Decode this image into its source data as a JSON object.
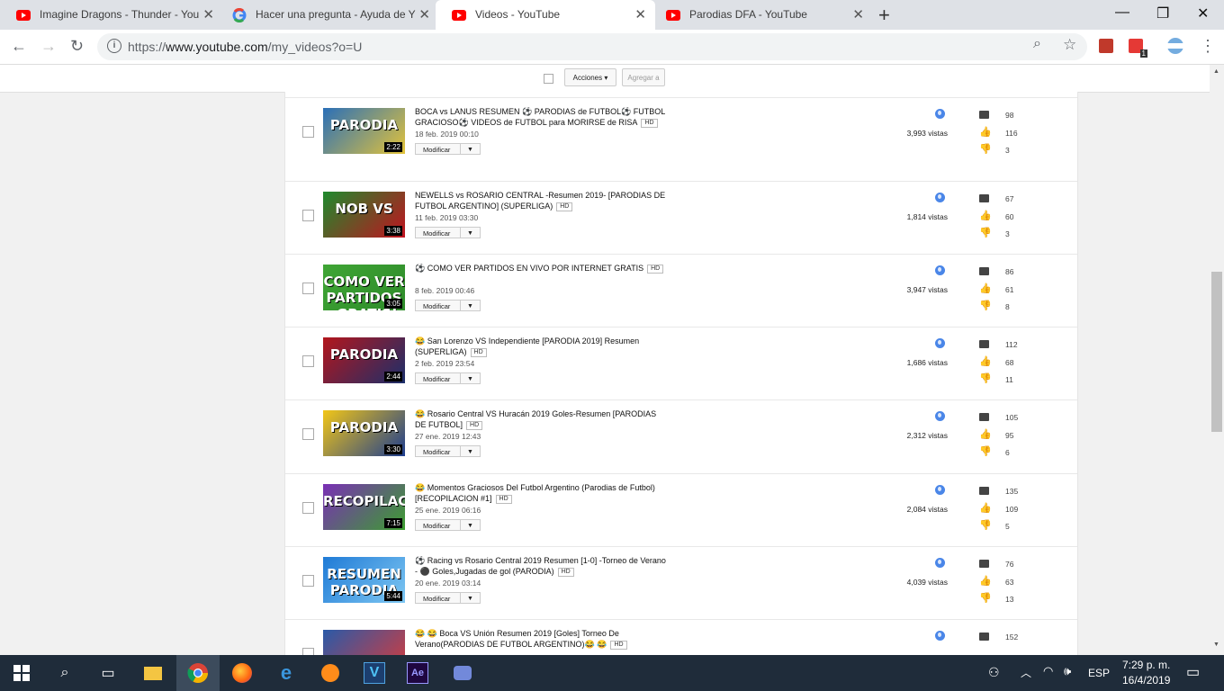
{
  "browser": {
    "tabs": [
      {
        "title": "Imagine Dragons - Thunder - You",
        "icon": "youtube-icon",
        "active": false
      },
      {
        "title": "Hacer una pregunta - Ayuda de Y",
        "icon": "google-icon",
        "active": false
      },
      {
        "title": "Videos - YouTube",
        "icon": "youtube-icon",
        "active": true
      },
      {
        "title": "Parodias DFA - YouTube",
        "icon": "youtube-icon",
        "active": false
      }
    ],
    "url_prefix": "https://",
    "url_host": "www.youtube.com",
    "url_path": "/my_videos?o=U",
    "extension_badge": "1"
  },
  "action_bar": {
    "actions_label": "Acciones",
    "add_label": "Agregar a"
  },
  "videos": [
    {
      "title": "BOCA vs LANUS RESUMEN ⚽ PARODIAS de FUTBOL⚽ FUTBOL GRACIOSO⚽ VIDEOS de FUTBOL para MORIRSE de RISA",
      "hd": "HD",
      "date": "18 feb. 2019 00:10",
      "duration": "2:22",
      "thumb_text": "PARODIA",
      "views": "3,993 vistas",
      "comments": "98",
      "likes": "116",
      "dislikes": "3",
      "colors": [
        "#2a6fb8",
        "#e3c33a"
      ]
    },
    {
      "title": "NEWELLS vs ROSARIO CENTRAL -Resumen 2019- [PARODIAS DE FUTBOL ARGENTINO] (SUPERLIGA)",
      "hd": "HD",
      "date": "11 feb. 2019 03:30",
      "duration": "3:38",
      "thumb_text": "NOB VS",
      "views": "1,814 vistas",
      "comments": "67",
      "likes": "60",
      "dislikes": "3",
      "colors": [
        "#1e8a2d",
        "#c1121f"
      ]
    },
    {
      "title": "⚽ COMO VER PARTIDOS EN VIVO POR INTERNET GRATIS",
      "hd": "HD",
      "date": "8 feb. 2019 00:46",
      "duration": "3:05",
      "thumb_text": "COMO VER PARTIDOS ¡GRATIS!",
      "views": "3,947 vistas",
      "comments": "86",
      "likes": "61",
      "dislikes": "8",
      "colors": [
        "#3fa535",
        "#2e8b2a"
      ]
    },
    {
      "title": "😂 San Lorenzo VS Independiente [PARODIA 2019] Resumen (SUPERLIGA)",
      "hd": "HD",
      "date": "2 feb. 2019 23:54",
      "duration": "2:44",
      "thumb_text": "PARODIA",
      "views": "1,686 vistas",
      "comments": "112",
      "likes": "68",
      "dislikes": "11",
      "colors": [
        "#b3161c",
        "#1b2f6b"
      ]
    },
    {
      "title": "😂 Rosario Central VS Huracán 2019 Goles-Resumen [PARODIAS DE FUTBOL]",
      "hd": "HD",
      "date": "27 ene. 2019 12:43",
      "duration": "3:30",
      "thumb_text": "PARODIA",
      "views": "2,312 vistas",
      "comments": "105",
      "likes": "95",
      "dislikes": "6",
      "colors": [
        "#f2c617",
        "#1d3d8f"
      ]
    },
    {
      "title": "😂 Momentos Graciosos Del Futbol Argentino (Parodias de Futbol) [RECOPILACION #1]",
      "hd": "HD",
      "date": "25 ene. 2019 06:16",
      "duration": "7:15",
      "thumb_text": "RECOPILACION",
      "views": "2,084 vistas",
      "comments": "135",
      "likes": "109",
      "dislikes": "5",
      "colors": [
        "#7a2fb5",
        "#3c9e2f"
      ]
    },
    {
      "title": "⚽ Racing vs Rosario Central 2019 Resumen [1-0] -Torneo de Verano - ⚫ Goles,Jugadas de gol (PARODIA)",
      "hd": "HD",
      "date": "20 ene. 2019 03:14",
      "duration": "5:44",
      "thumb_text": "RESUMEN PARODIA",
      "views": "4,039 vistas",
      "comments": "76",
      "likes": "63",
      "dislikes": "13",
      "colors": [
        "#1f7ad6",
        "#7ec7f2"
      ]
    },
    {
      "title": "😂 😂 Boca VS Unión Resumen 2019 [Goles] Torneo De Verano(PARODIAS DE FUTBOL ARGENTINO)😂 😂",
      "hd": "HD",
      "date": "",
      "duration": "",
      "thumb_text": "",
      "views": "",
      "comments": "152",
      "likes": "",
      "dislikes": "",
      "colors": [
        "#2a5aa8",
        "#d73b3b"
      ]
    }
  ],
  "modify_label": "Modificar",
  "taskbar": {
    "lang": "ESP",
    "time": "7:29 p. m.",
    "date": "16/4/2019"
  }
}
